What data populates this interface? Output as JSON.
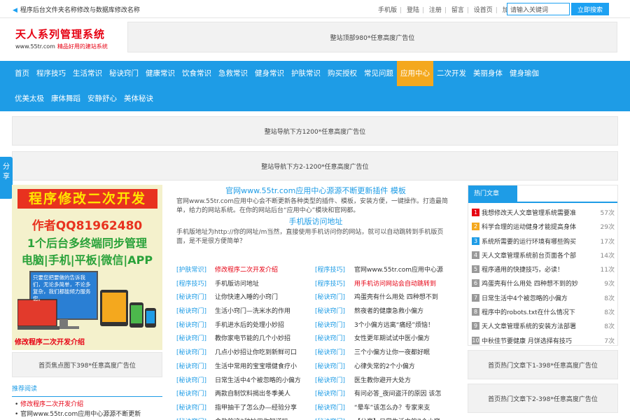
{
  "topbar": {
    "notice": "程序后台文件夹名称修改与数据库修改名称",
    "links": [
      "手机版",
      "登陆",
      "注册",
      "留言",
      "设首页",
      "加收藏"
    ],
    "search_placeholder": "请输入关键词",
    "search_button": "立即搜索"
  },
  "logo": {
    "title": "天人系列管理系统",
    "domain": "www.55tr.com",
    "slogan": "精品好用的建站系统"
  },
  "ads": {
    "top": "整站顶部980*任意高度广告位",
    "nav1": "整站导航下方1200*任意高度广告位",
    "nav2": "整站导航下方2-1200*任意高度广告位",
    "focus": "首页焦点图下398*任意高度广告位",
    "hot1": "首页热门文章下1-398*任意高度广告位",
    "hot2": "首页热门文章下2-398*任意高度广告位"
  },
  "nav": {
    "row1": [
      "首页",
      "程序技巧",
      "生活常识",
      "秘诀窍门",
      "健康常识",
      "饮食常识",
      "急救常识",
      "健身常识",
      "护肤常识",
      "购买授权",
      "常见问题",
      "应用中心",
      "二次开发",
      "美丽身体",
      "健身瑜伽"
    ],
    "row2": [
      "优美太极",
      "康体舞蹈",
      "安静舒心",
      "美体秘诀"
    ],
    "active": "应用中心"
  },
  "share": {
    "label": "分享"
  },
  "banner": {
    "line1": "程序修改二次开发",
    "line2": "作者QQ81962480",
    "line3": "1个后台多终端同步管理",
    "line4": "电脑|手机|平板|微信|APP",
    "screen_text": "只要您把要做的告诉我们，无论多简单，不论多复杂，我们都能倾力服务您。",
    "caption": "修改程序二次开发介绍"
  },
  "featured": {
    "title": "官网www.55tr.com应用中心源源不断更新插件 模板",
    "desc": "官网www.55tr.com应用中心会不断更新各种类型的插件、模板，安装方便，一键操作。打造最简单，给力的网站系统。在你的网站后台“应用中心”模块和官网都。",
    "title2": "手机版访问地址",
    "desc2": "手机版地址为http://你的网址/m当然，直接使用手机访问你的网站，就可以自动跳转到手机版页面，是不是很方便简单？"
  },
  "articles": [
    [
      {
        "cat": "[护肤常识]",
        "title": "修改程序二次开发介绍",
        "red": true
      },
      {
        "cat": "[程序技巧]",
        "title": "官网www.55tr.com应用中心源",
        "red": false
      }
    ],
    [
      {
        "cat": "[程序技巧]",
        "title": "手机版访问地址",
        "red": false
      },
      {
        "cat": "[程序技巧]",
        "title": "用手机访问网站会自动跳转到",
        "red": true
      }
    ],
    [
      {
        "cat": "[秘诀窍门]",
        "title": "让你快速入睡的小窍门",
        "red": false
      },
      {
        "cat": "[秘诀窍门]",
        "title": "鸡蛋壳有什么用处 四种想不到",
        "red": false
      }
    ],
    [
      {
        "cat": "[秘诀窍门]",
        "title": "生活小窍门—洗米水的作用",
        "red": false
      },
      {
        "cat": "[秘诀窍门]",
        "title": "熬夜者的健康急救小偏方",
        "red": false
      }
    ],
    [
      {
        "cat": "[秘诀窍门]",
        "title": "手机进水后的处理小妙招",
        "red": false
      },
      {
        "cat": "[秘诀窍门]",
        "title": "3个小偏方远离“痛经”烦恼！",
        "red": false
      }
    ],
    [
      {
        "cat": "[秘诀窍门]",
        "title": "教你家电节能的几个小妙招",
        "red": false
      },
      {
        "cat": "[秘诀窍门]",
        "title": "女性更年期试试中医小偏方",
        "red": false
      }
    ],
    [
      {
        "cat": "[秘诀窍门]",
        "title": "几点小妙招让你吃到新鲜可口",
        "red": false
      },
      {
        "cat": "[秘诀窍门]",
        "title": "三个小偏方让你一夜都好眠",
        "red": false
      }
    ],
    [
      {
        "cat": "[秘诀窍门]",
        "title": "生活中常用的宝宝喂健食疗小",
        "red": false
      },
      {
        "cat": "[秘诀窍门]",
        "title": "心律失常的2个小偏方",
        "red": false
      }
    ],
    [
      {
        "cat": "[秘诀窍门]",
        "title": "日常生活中4个被忽略的小偏方",
        "red": false
      },
      {
        "cat": "[秘诀窍门]",
        "title": "医生教你避开大处方",
        "red": false
      }
    ],
    [
      {
        "cat": "[秘诀窍门]",
        "title": "两款自制饮料揭出冬季美人",
        "red": false
      },
      {
        "cat": "[秘诀窍门]",
        "title": "有问必答_夜间盗汗的原因 该怎",
        "red": false
      }
    ],
    [
      {
        "cat": "[秘诀窍门]",
        "title": "指甲抽干了怎么办—经验分享",
        "red": false
      },
      {
        "cat": "[秘诀窍门]",
        "title": "“晕车”该怎么办？专家来支",
        "red": false
      }
    ],
    [
      {
        "cat": "[秘诀窍门]",
        "title": "食盐的这3种妙用你知道吗",
        "red": false
      },
      {
        "cat": "[秘诀窍门]",
        "title": "【分享】日常生活中的7个小窍",
        "red": false
      }
    ]
  ],
  "hot": {
    "title": "热门文章",
    "items": [
      {
        "n": "1",
        "title": "我想修改天人文章管理系统需要准",
        "count": "57次"
      },
      {
        "n": "2",
        "title": "科学合理的运动健身才能提高身体",
        "count": "29次"
      },
      {
        "n": "3",
        "title": "系统所需要的运行环境有哪些购买",
        "count": "17次"
      },
      {
        "n": "4",
        "title": "天人文章管理系统前台页面各个部",
        "count": "14次"
      },
      {
        "n": "5",
        "title": "程序通用的快捷技巧，必读！",
        "count": "11次"
      },
      {
        "n": "6",
        "title": "鸡蛋壳有什么用处 四种想不到的妙",
        "count": "9次"
      },
      {
        "n": "7",
        "title": "日常生活中4个被忽略的小偏方",
        "count": "8次"
      },
      {
        "n": "8",
        "title": "程序中的robots.txt在什么情况下",
        "count": "8次"
      },
      {
        "n": "9",
        "title": "天人文章管理系统的安装方法部署",
        "count": "8次"
      },
      {
        "n": "10",
        "title": "中秋佳节要健康 月饼选择有技巧",
        "count": "7次"
      }
    ]
  },
  "recommend": {
    "title": "推荐阅读",
    "items": [
      "修改程序二次开发介绍",
      "官网www.55tr.com应用中心源源不断更新"
    ]
  }
}
